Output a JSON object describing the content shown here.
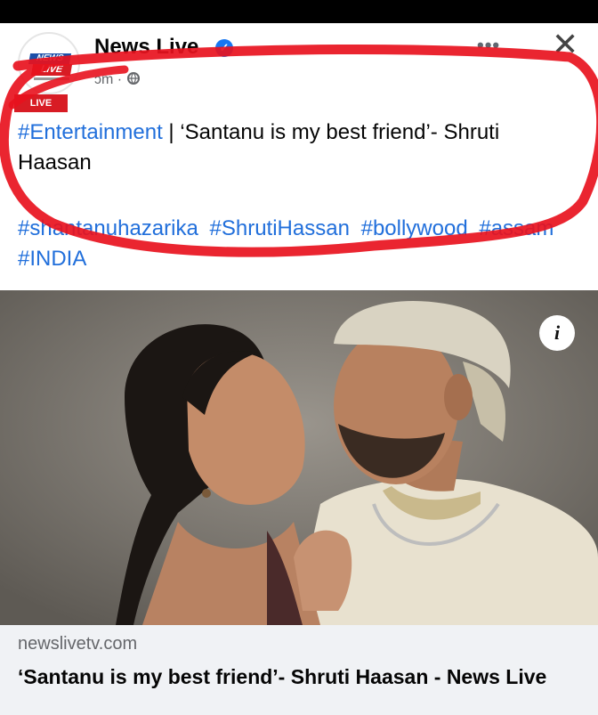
{
  "post": {
    "page_name": "News Live",
    "verified_glyph": "✓",
    "meta_visible": "ɔm · ",
    "more_glyph": "•••",
    "close_glyph": "✕",
    "logo_top": "NEWS",
    "logo_bottom": "LIVE",
    "live_badge": "LIVE",
    "text_hashtag": "#Entertainment",
    "text_body": " | ‘Santanu is my best friend’- Shruti Haasan",
    "tags": [
      "#shantanuhazarika",
      "#ShrutiHassan",
      "#bollywood",
      "#assam",
      "#INDIA"
    ]
  },
  "photo": {
    "info_glyph": "i"
  },
  "link_preview": {
    "domain": "newslivetv.com",
    "title": "‘Santanu is my best friend’- Shruti Haasan - News Live"
  },
  "colors": {
    "hashtag": "#216fdb",
    "annotation_red": "#e8121e",
    "verified": "#1877f2"
  }
}
